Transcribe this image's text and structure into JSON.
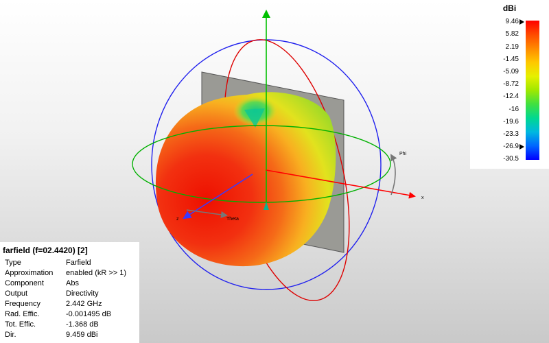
{
  "legend": {
    "unit": "dBi",
    "ticks": [
      "9.46",
      "5.82",
      "2.19",
      "-1.45",
      "-5.09",
      "-8.72",
      "-12.4",
      "-16",
      "-19.6",
      "-23.3",
      "-26.9",
      "-30.5"
    ]
  },
  "axes": {
    "x_label": "x",
    "theta_label": "Theta",
    "phi_label": "Phi",
    "origin_label": "z"
  },
  "info": {
    "title": "farfield (f=02.4420) [2]",
    "rows": [
      {
        "key": "Type",
        "value": "Farfield"
      },
      {
        "key": "Approximation",
        "value": "enabled (kR >> 1)"
      },
      {
        "key": "Component",
        "value": "Abs"
      },
      {
        "key": "Output",
        "value": "Directivity"
      },
      {
        "key": "Frequency",
        "value": "2.442 GHz"
      },
      {
        "key": "Rad. Effic.",
        "value": "-0.001495 dB"
      },
      {
        "key": "Tot. Effic.",
        "value": "-1.368 dB"
      },
      {
        "key": "Dir.",
        "value": "9.459 dBi"
      }
    ]
  },
  "colors": {
    "x_axis": "#ff0000",
    "y_axis": "#00c000",
    "z_axis": "#0000ff",
    "ground_plane": "#9a9a95"
  }
}
